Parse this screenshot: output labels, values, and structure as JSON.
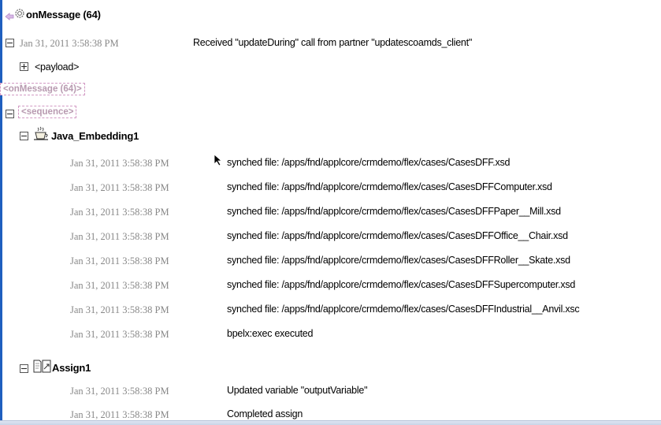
{
  "header": {
    "title": "onMessage (64)"
  },
  "top_entry": {
    "timestamp": "Jan 31, 2011 3:58:38 PM",
    "message": "Received \"updateDuring\" call from partner \"updatescoamds_client\""
  },
  "payload_label": "<payload>",
  "onmessage_tag": "<onMessage (64)>",
  "sequence_tag": "<sequence>",
  "java_embedding": {
    "title": "Java_Embedding1",
    "entries": [
      {
        "timestamp": "Jan 31, 2011 3:58:38 PM",
        "message": "synched file: /apps/fnd/applcore/crmdemo/flex/cases/CasesDFF.xsd"
      },
      {
        "timestamp": "Jan 31, 2011 3:58:38 PM",
        "message": "synched file: /apps/fnd/applcore/crmdemo/flex/cases/CasesDFFComputer.xsd"
      },
      {
        "timestamp": "Jan 31, 2011 3:58:38 PM",
        "message": "synched file: /apps/fnd/applcore/crmdemo/flex/cases/CasesDFFPaper__Mill.xsd"
      },
      {
        "timestamp": "Jan 31, 2011 3:58:38 PM",
        "message": "synched file: /apps/fnd/applcore/crmdemo/flex/cases/CasesDFFOffice__Chair.xsd"
      },
      {
        "timestamp": "Jan 31, 2011 3:58:38 PM",
        "message": "synched file: /apps/fnd/applcore/crmdemo/flex/cases/CasesDFFRoller__Skate.xsd"
      },
      {
        "timestamp": "Jan 31, 2011 3:58:38 PM",
        "message": "synched file: /apps/fnd/applcore/crmdemo/flex/cases/CasesDFFSupercomputer.xsd"
      },
      {
        "timestamp": "Jan 31, 2011 3:58:38 PM",
        "message": "synched file: /apps/fnd/applcore/crmdemo/flex/cases/CasesDFFIndustrial__Anvil.xsc"
      },
      {
        "timestamp": "Jan 31, 2011 3:58:38 PM",
        "message": "bpelx:exec executed"
      }
    ]
  },
  "assign": {
    "title": "Assign1",
    "entries": [
      {
        "timestamp": "Jan 31, 2011 3:58:38 PM",
        "message": "Updated variable \"outputVariable\""
      },
      {
        "timestamp": "Jan 31, 2011 3:58:38 PM",
        "message": "Completed assign"
      }
    ]
  },
  "icons": {
    "header": "gear-icon",
    "java": "coffee-cup-icon",
    "assign": "assign-icon",
    "pointer": "mouse-pointer-icon"
  },
  "colors": {
    "accent_blue": "#1f5fbf",
    "dashed_pink": "#d29ac4",
    "timestamp_gray": "#888888"
  }
}
